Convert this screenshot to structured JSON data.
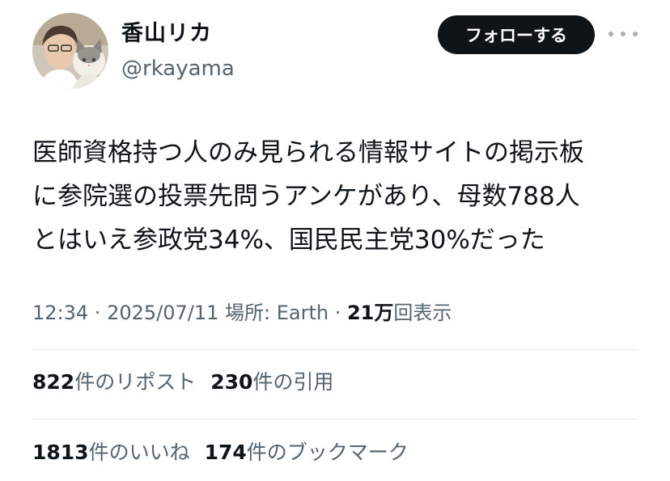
{
  "user": {
    "name": "香山リカ",
    "handle": "@rkayama"
  },
  "follow_label": "フォローする",
  "tweet": {
    "text": "医師資格持つ人のみ見られる情報サイトの掲示板\nに参院選の投票先問うアンケがあり、母数788人\nとはいえ参政党34%、国民民主党30%だった"
  },
  "meta": {
    "time": "12:34",
    "sep1": " · ",
    "date": "2025/07/11",
    "location": " 場所: Earth",
    "sep2": " · ",
    "views_count": "21万",
    "views_label": "回表示"
  },
  "stats": {
    "reposts_count": "822",
    "reposts_label": "件のリポスト",
    "quotes_count": "230",
    "quotes_label": "件の引用",
    "likes_count": "1813",
    "likes_label": "件のいいね",
    "bookmarks_count": "174",
    "bookmarks_label": "件のブックマーク"
  },
  "icons": {
    "more": "more-horizontal-icon"
  }
}
